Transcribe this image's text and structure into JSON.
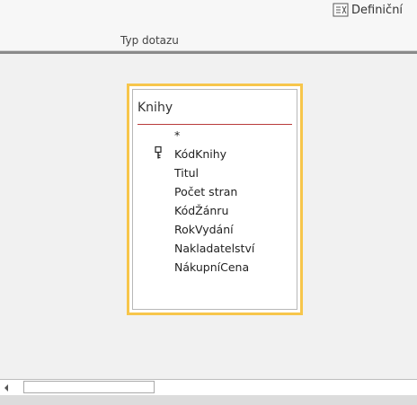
{
  "ribbon": {
    "definition_label": "Definiční",
    "definition_icon": "definition-icon",
    "group_label": "Typ dotazu"
  },
  "table": {
    "title": "Knihy",
    "fields": [
      {
        "name": "*",
        "primary_key": false
      },
      {
        "name": "KódKnihy",
        "primary_key": true
      },
      {
        "name": "Titul",
        "primary_key": false
      },
      {
        "name": "Počet stran",
        "primary_key": false
      },
      {
        "name": "KódŽánru",
        "primary_key": false
      },
      {
        "name": "RokVydání",
        "primary_key": false
      },
      {
        "name": "Nakladatelství",
        "primary_key": false
      },
      {
        "name": "NákupníCena",
        "primary_key": false
      }
    ],
    "key_icon": "key-icon"
  },
  "colors": {
    "selection_border": "#f7c64b",
    "title_underline": "#b83b3b"
  }
}
